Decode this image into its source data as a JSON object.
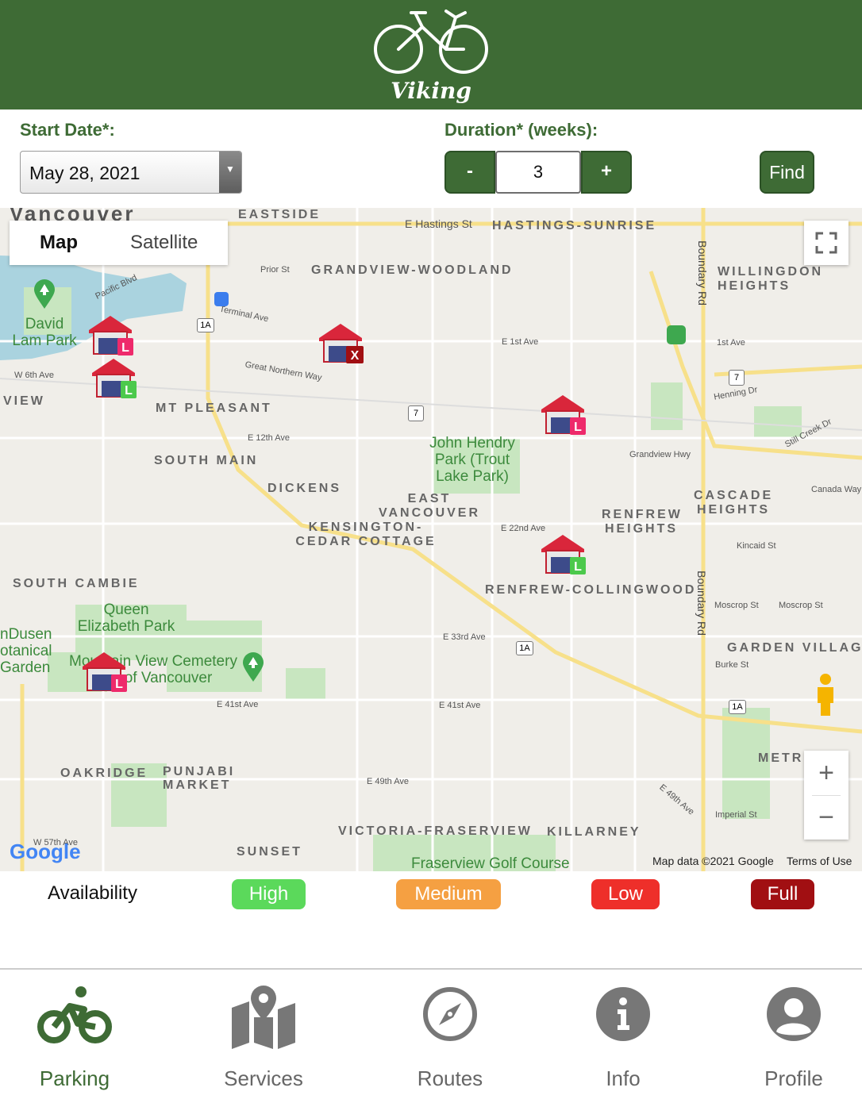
{
  "header": {
    "app_name": "Viking"
  },
  "form": {
    "start_date_label": "Start Date*:",
    "start_date_value": "May 28, 2021",
    "duration_label": "Duration* (weeks):",
    "decrement_label": "-",
    "increment_label": "+",
    "duration_value": "3",
    "find_label": "Find"
  },
  "map": {
    "tabs": {
      "map": "Map",
      "satellite": "Satellite"
    },
    "areas": {
      "vancouver": "Vancouver",
      "eastside": "EASTSIDE",
      "hastings_sunrise": "HASTINGS-SUNRISE",
      "grandview": "GRANDVIEW-WOODLAND",
      "willingdon": "WILLINGDON HEIGHTS",
      "view": "VIEW",
      "mt_pleasant": "MT PLEASANT",
      "south_main": "SOUTH MAIN",
      "dickens": "DICKENS",
      "east_vancouver": "EAST VANCOUVER",
      "kensington": "KENSINGTON-CEDAR COTTAGE",
      "renfrew_heights": "RENFREW HEIGHTS",
      "cascade": "CASCADE HEIGHTS",
      "renfrew_collingwood": "RENFREW-COLLINGWOOD",
      "south_cambie": "SOUTH CAMBIE",
      "garden_village": "GARDEN VILLAGE",
      "oakridge": "OAKRIDGE",
      "punjabi": "PUNJABI MARKET",
      "victoria_fraserview": "VICTORIA-FRASERVIEW",
      "killarney": "KILLARNEY",
      "sunset": "SUNSET",
      "metro": "METRO"
    },
    "parks": {
      "david_lam": "David Lam Park",
      "john_hendry": "John Hendry Park (Trout Lake Park)",
      "queen_elizabeth": "Queen Elizabeth Park",
      "vandusen": "nDusen otanical Garden",
      "cemetery": "Mountain View Cemetery City of Vancouver",
      "fraserview": "Fraserview Golf Course"
    },
    "streets": {
      "e_hastings": "E Hastings St",
      "prior": "Prior St",
      "terminal": "Terminal Ave",
      "great_northern": "Great Northern Way",
      "e_1st": "E 1st Ave",
      "first_ave": "1st Ave",
      "w_6th": "W 6th Ave",
      "e_12th": "E 12th Ave",
      "grandview_hwy": "Grandview Hwy",
      "e_22nd": "E 22nd Ave",
      "kincaid": "Kincaid St",
      "moscrop1": "Moscrop St",
      "moscrop2": "Moscrop St",
      "burke": "Burke St",
      "e_33rd": "E 33rd Ave",
      "e_41st_a": "E 41st Ave",
      "e_41st_b": "E 41st Ave",
      "e_49th": "E 49th Ave",
      "e_49th_b": "E 49th Ave",
      "imperial": "Imperial St",
      "w_57th": "W 57th Ave",
      "boundary1": "Boundary Rd",
      "boundary2": "Boundary Rd",
      "canada_way": "Canada Way",
      "henning": "Henning Dr",
      "still_creek": "Still Creek Dr",
      "pacific": "Pacific Blvd"
    },
    "shields": {
      "r1a": "1A",
      "r7": "7"
    },
    "attribution": "Map data ©2021 Google",
    "terms": "Terms of Use",
    "google": "Google",
    "markers": [
      {
        "label": "L",
        "status": "Low"
      },
      {
        "label": "L",
        "status": "High"
      },
      {
        "label": "X",
        "status": "Full"
      },
      {
        "label": "L",
        "status": "Low"
      },
      {
        "label": "L",
        "status": "High"
      },
      {
        "label": "L",
        "status": "Low"
      }
    ]
  },
  "legend": {
    "title": "Availability",
    "items": [
      {
        "label": "High",
        "color": "#5bd95b"
      },
      {
        "label": "Medium",
        "color": "#f5a042"
      },
      {
        "label": "Low",
        "color": "#ee2f2a"
      },
      {
        "label": "Full",
        "color": "#a10f12"
      }
    ]
  },
  "tabs": [
    {
      "label": "Parking",
      "icon": "bicycle-icon",
      "active": true
    },
    {
      "label": "Services",
      "icon": "map-pin-icon"
    },
    {
      "label": "Routes",
      "icon": "compass-icon"
    },
    {
      "label": "Info",
      "icon": "info-icon"
    },
    {
      "label": "Profile",
      "icon": "user-icon"
    }
  ],
  "colors": {
    "brand": "#3e6b35",
    "map_bg": "#f0eee9",
    "park": "#c8e6c0",
    "water": "#aad3df",
    "road_major": "#f7e08a"
  }
}
